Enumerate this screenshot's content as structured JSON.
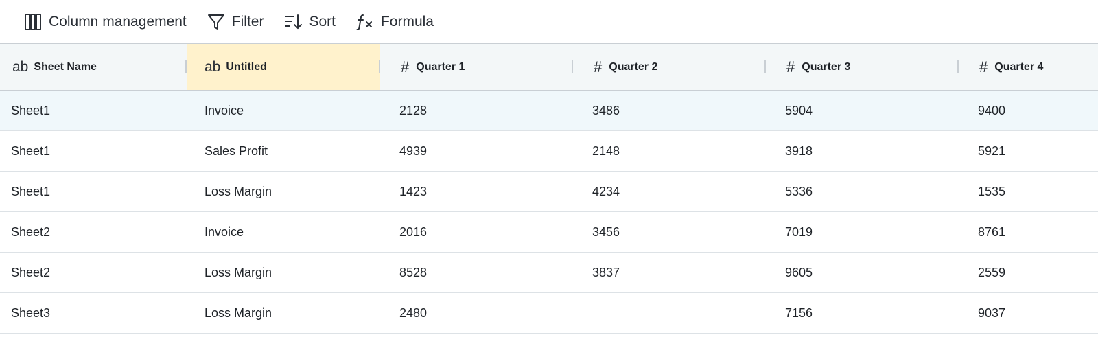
{
  "toolbar": {
    "column_management": {
      "label": "Column management",
      "icon": "columns-icon"
    },
    "filter": {
      "label": "Filter",
      "icon": "filter-icon"
    },
    "sort": {
      "label": "Sort",
      "icon": "sort-icon"
    },
    "formula": {
      "label": "Formula",
      "icon": "formula-icon"
    }
  },
  "table": {
    "columns": [
      {
        "label": "Sheet Name",
        "type_icon": "ab"
      },
      {
        "label": "Untitled",
        "type_icon": "ab"
      },
      {
        "label": "Quarter 1",
        "type_icon": "#"
      },
      {
        "label": "Quarter 2",
        "type_icon": "#"
      },
      {
        "label": "Quarter 3",
        "type_icon": "#"
      },
      {
        "label": "Quarter 4",
        "type_icon": "#"
      }
    ],
    "selected_column_color": "#fff2cc",
    "hover_row_color": "#f0f8fb",
    "rows": [
      [
        "Sheet1",
        "Invoice",
        "2128",
        "3486",
        "5904",
        "9400"
      ],
      [
        "Sheet1",
        "Sales Profit",
        "4939",
        "2148",
        "3918",
        "5921"
      ],
      [
        "Sheet1",
        "Loss Margin",
        "1423",
        "4234",
        "5336",
        "1535"
      ],
      [
        "Sheet2",
        "Invoice",
        "2016",
        "3456",
        "7019",
        "8761"
      ],
      [
        "Sheet2",
        "Loss Margin",
        "8528",
        "3837",
        "9605",
        "2559"
      ],
      [
        "Sheet3",
        "Loss Margin",
        "2480",
        "",
        "7156",
        "9037"
      ]
    ]
  }
}
